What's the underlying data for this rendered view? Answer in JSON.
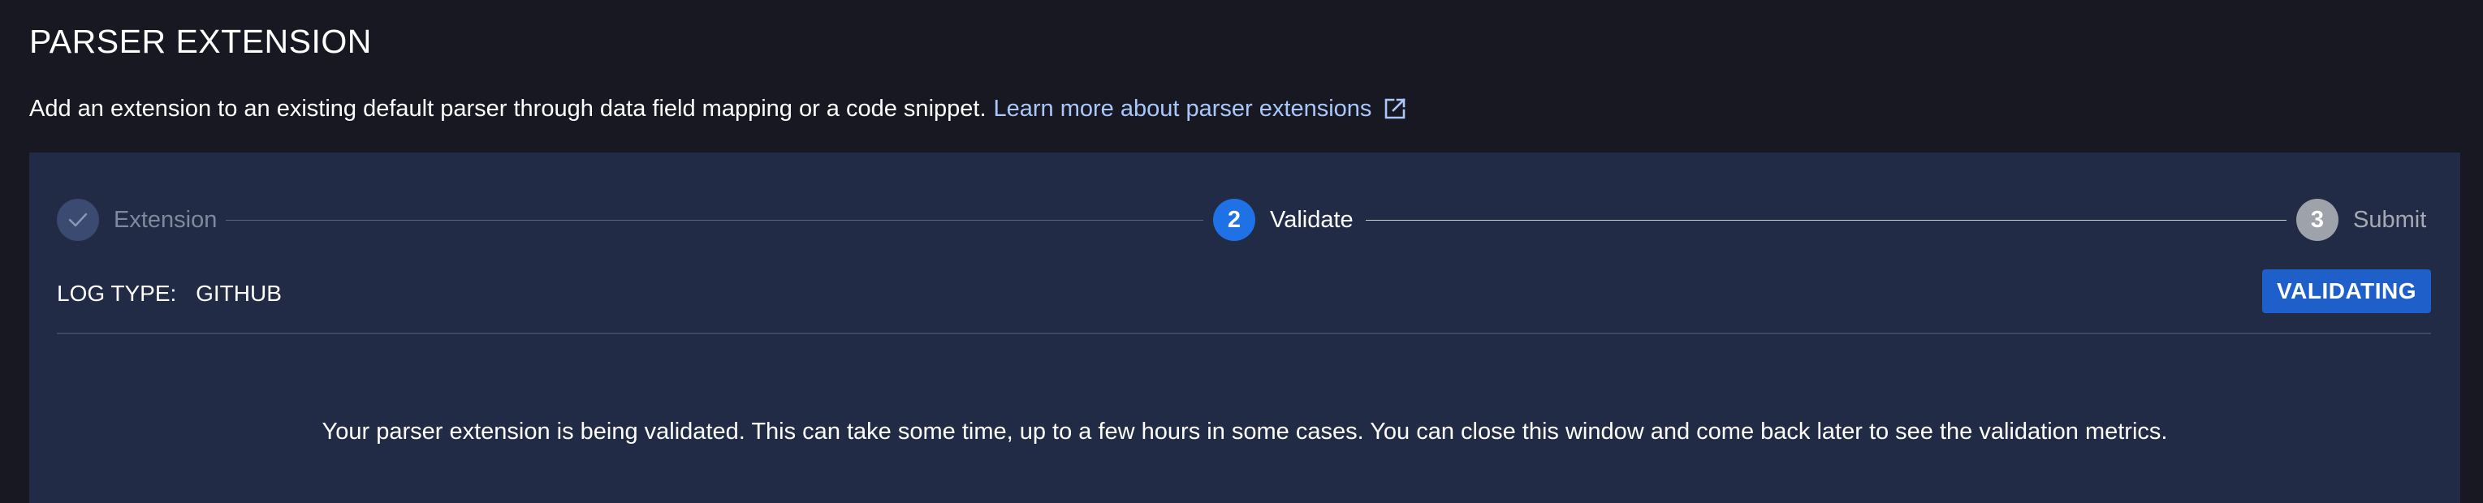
{
  "page": {
    "title": "PARSER EXTENSION",
    "description": "Add an extension to an existing default parser through data field mapping or a code snippet.",
    "learn_more_link": "Learn more about parser extensions",
    "link_icon": "external-link-icon"
  },
  "stepper": {
    "steps": [
      {
        "number": "",
        "label": "Extension",
        "state": "completed",
        "icon": "checkmark-icon"
      },
      {
        "number": "2",
        "label": "Validate",
        "state": "active"
      },
      {
        "number": "3",
        "label": "Submit",
        "state": "pending"
      }
    ]
  },
  "log_type": {
    "label": "LOG TYPE:",
    "value": "GITHUB"
  },
  "status": {
    "label": "VALIDATING"
  },
  "message": "Your parser extension is being validated. This can take some time, up to a few hours in some cases. You can close this window and come back later to see the validation metrics.",
  "colors": {
    "background": "#171822",
    "panel": "#212b45",
    "accent": "#1f72e6",
    "link": "#a9c7fb",
    "badge": "#1e5fc9"
  }
}
